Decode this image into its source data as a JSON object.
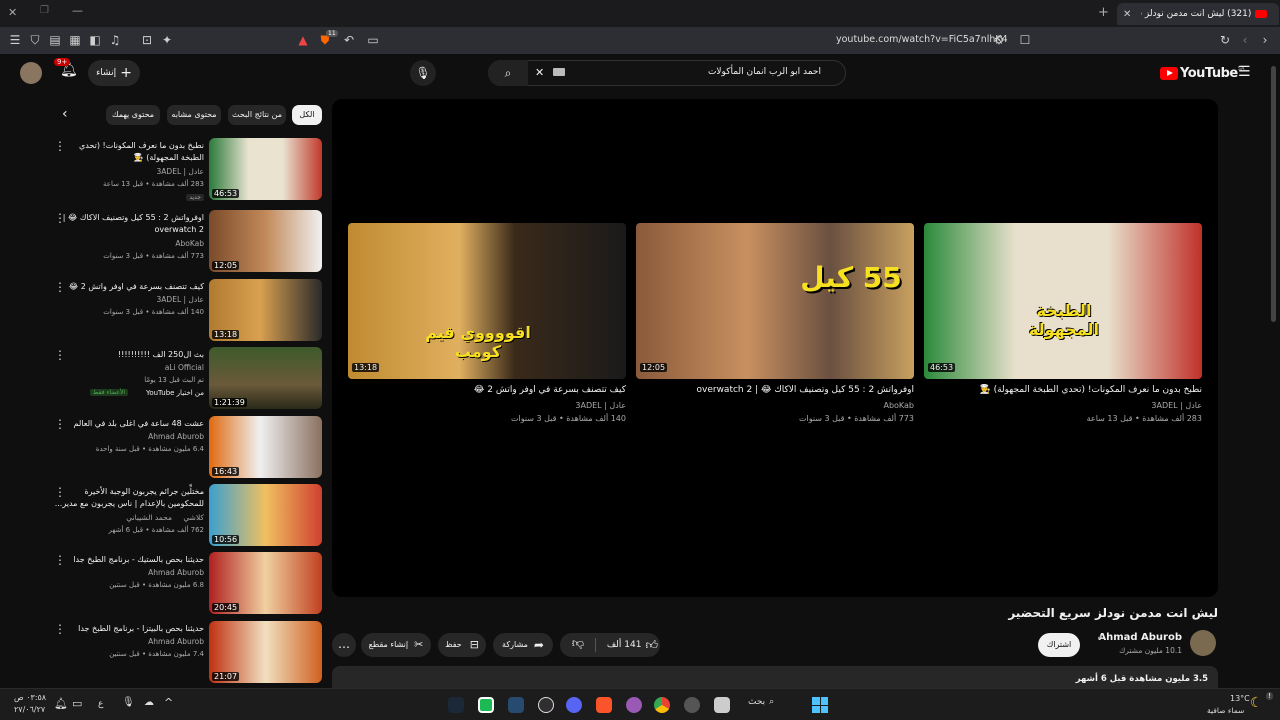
{
  "browser": {
    "tab_title": "(321) ليش انت مدمن نودلز سريع",
    "url": "youtube.com/watch?v=FiC5a7nlhK4",
    "extension_badge": "11"
  },
  "header": {
    "logo_text": "YouTube",
    "logo_region": "SA",
    "search_value": "احمد ابو الرب انمان المأكولات",
    "create_label": "إنشاء",
    "notif_count": "9+"
  },
  "chips": [
    "الكل",
    "من نتائج البحث",
    "محتوى مشابه",
    "محتوى يهمك"
  ],
  "recs": [
    {
      "title": "نطبخ بدون ما نعرف المكونات! (تحدي الطبخة المجهولة) 👨‍🍳",
      "channel": "عادل | 3ADEL",
      "meta": "283 ألف مشاهدة • قبل 13 ساعة",
      "badge": "جديد",
      "duration": "46:53"
    },
    {
      "title": "اوفرواتش 2 : 55 كيل وتصنيف الاكاك 😂 | overwatch 2",
      "channel": "AboKab",
      "meta": "773 ألف مشاهدة • قبل 3 سنوات",
      "badge": "",
      "duration": "12:05"
    },
    {
      "title": "كيف تتصنف بسرعة في اوفر واتش 2 😂",
      "channel": "عادل | 3ADEL",
      "meta": "140 ألف مشاهدة • قبل 3 سنوات",
      "badge": "",
      "duration": "13:18"
    },
    {
      "title": "بث ال250 الف !!!!!!!!!!",
      "channel": "aLi Official",
      "meta": "تم البث قبل 13 يومًا",
      "badge": "الأعضاء فقط",
      "extra": "من اختيار YouTube",
      "duration": "1:21:39"
    },
    {
      "title": "عشت 48 ساعة في اغلى بلد في العالم",
      "channel": "Ahmad Aburob",
      "meta": "6.4 مليون مشاهدة • قبل سنة واحدة",
      "badge": "",
      "duration": "16:43"
    },
    {
      "title": "مختلِّين جرائم يجربون الوجبة الأخيرة للمحكومين بالإعدام | ناس يجربون مع مدير...",
      "channel": "محمد الشيباني",
      "meta": "762 ألف مشاهدة • قبل 6 أشهر",
      "badge": "",
      "extra": "كلاشي",
      "duration": "10:56"
    },
    {
      "title": "حديثنا بحص بالستيك - برنامج الطبخ جدا",
      "channel": "Ahmad Aburob",
      "meta": "6.8 مليون مشاهدة • قبل سنتين",
      "badge": "",
      "duration": "20:45"
    },
    {
      "title": "حديثنا بحص بالبيتزا - برنامج الطبخ جدا",
      "channel": "Ahmad Aburob",
      "meta": "7.4 مليون مشاهدة • قبل سنتين",
      "badge": "",
      "duration": "21:07"
    }
  ],
  "endscreen": [
    {
      "title": "نطبخ بدون ما نعرف المكونات! (تحدي الطبخة المجهولة) 👨‍🍳",
      "channel": "عادل | 3ADEL",
      "meta": "283 ألف مشاهدة • قبل 13 ساعة",
      "duration": "46:53",
      "thumb_text": "الطبخة المجهولة"
    },
    {
      "title": "اوفرواتش 2 : 55 كيل وتصنيف الاكاك 😂 | overwatch 2",
      "channel": "AboKab",
      "meta": "773 ألف مشاهدة • قبل 3 سنوات",
      "duration": "12:05",
      "thumb_text": "55 كيل"
    },
    {
      "title": "كيف تتصنف بسرعة في اوفر واتش 2 😂",
      "channel": "عادل | 3ADEL",
      "meta": "140 ألف مشاهدة • قبل 3 سنوات",
      "duration": "13:18",
      "thumb_text": "اقووووي قيم كومب"
    }
  ],
  "video": {
    "title": "ليش انت مدمن نودلز سريع التحضير",
    "channel": "Ahmad Aburob",
    "subs": "10.1 مليون مشترك",
    "subscribe_label": "اشتراك",
    "like_count": "141 ألف",
    "share_label": "مشاركة",
    "save_label": "حفظ",
    "clip_label": "إنشاء مقطع",
    "desc_meta": "3.5 مليون مشاهدة  قبل 6 أشهر"
  },
  "taskbar": {
    "time": "٠٣:٥٨ ص",
    "date": "٢٧/٠٦/٢٧",
    "search_label": "بحث",
    "weather_temp": "13°C",
    "weather_text": "سماء صافية",
    "lang": "ع"
  }
}
